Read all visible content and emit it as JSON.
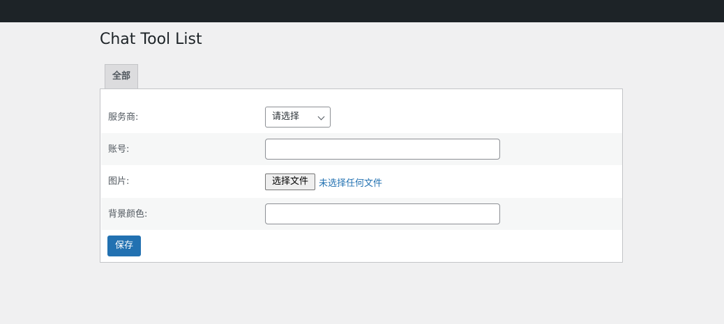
{
  "page": {
    "title": "Chat Tool List"
  },
  "tabs": [
    {
      "label": "全部"
    }
  ],
  "form": {
    "provider": {
      "label": "服务商:",
      "selected": "请选择"
    },
    "account": {
      "label": "账号:",
      "value": ""
    },
    "image": {
      "label": "图片:",
      "button_label": "选择文件",
      "status": "未选择任何文件"
    },
    "background_color": {
      "label": "背景颜色:",
      "value": ""
    },
    "save_label": "保存"
  },
  "colors": {
    "admin_bar": "#1d2327",
    "accent": "#2271b1",
    "page_background": "#f0f0f1"
  }
}
